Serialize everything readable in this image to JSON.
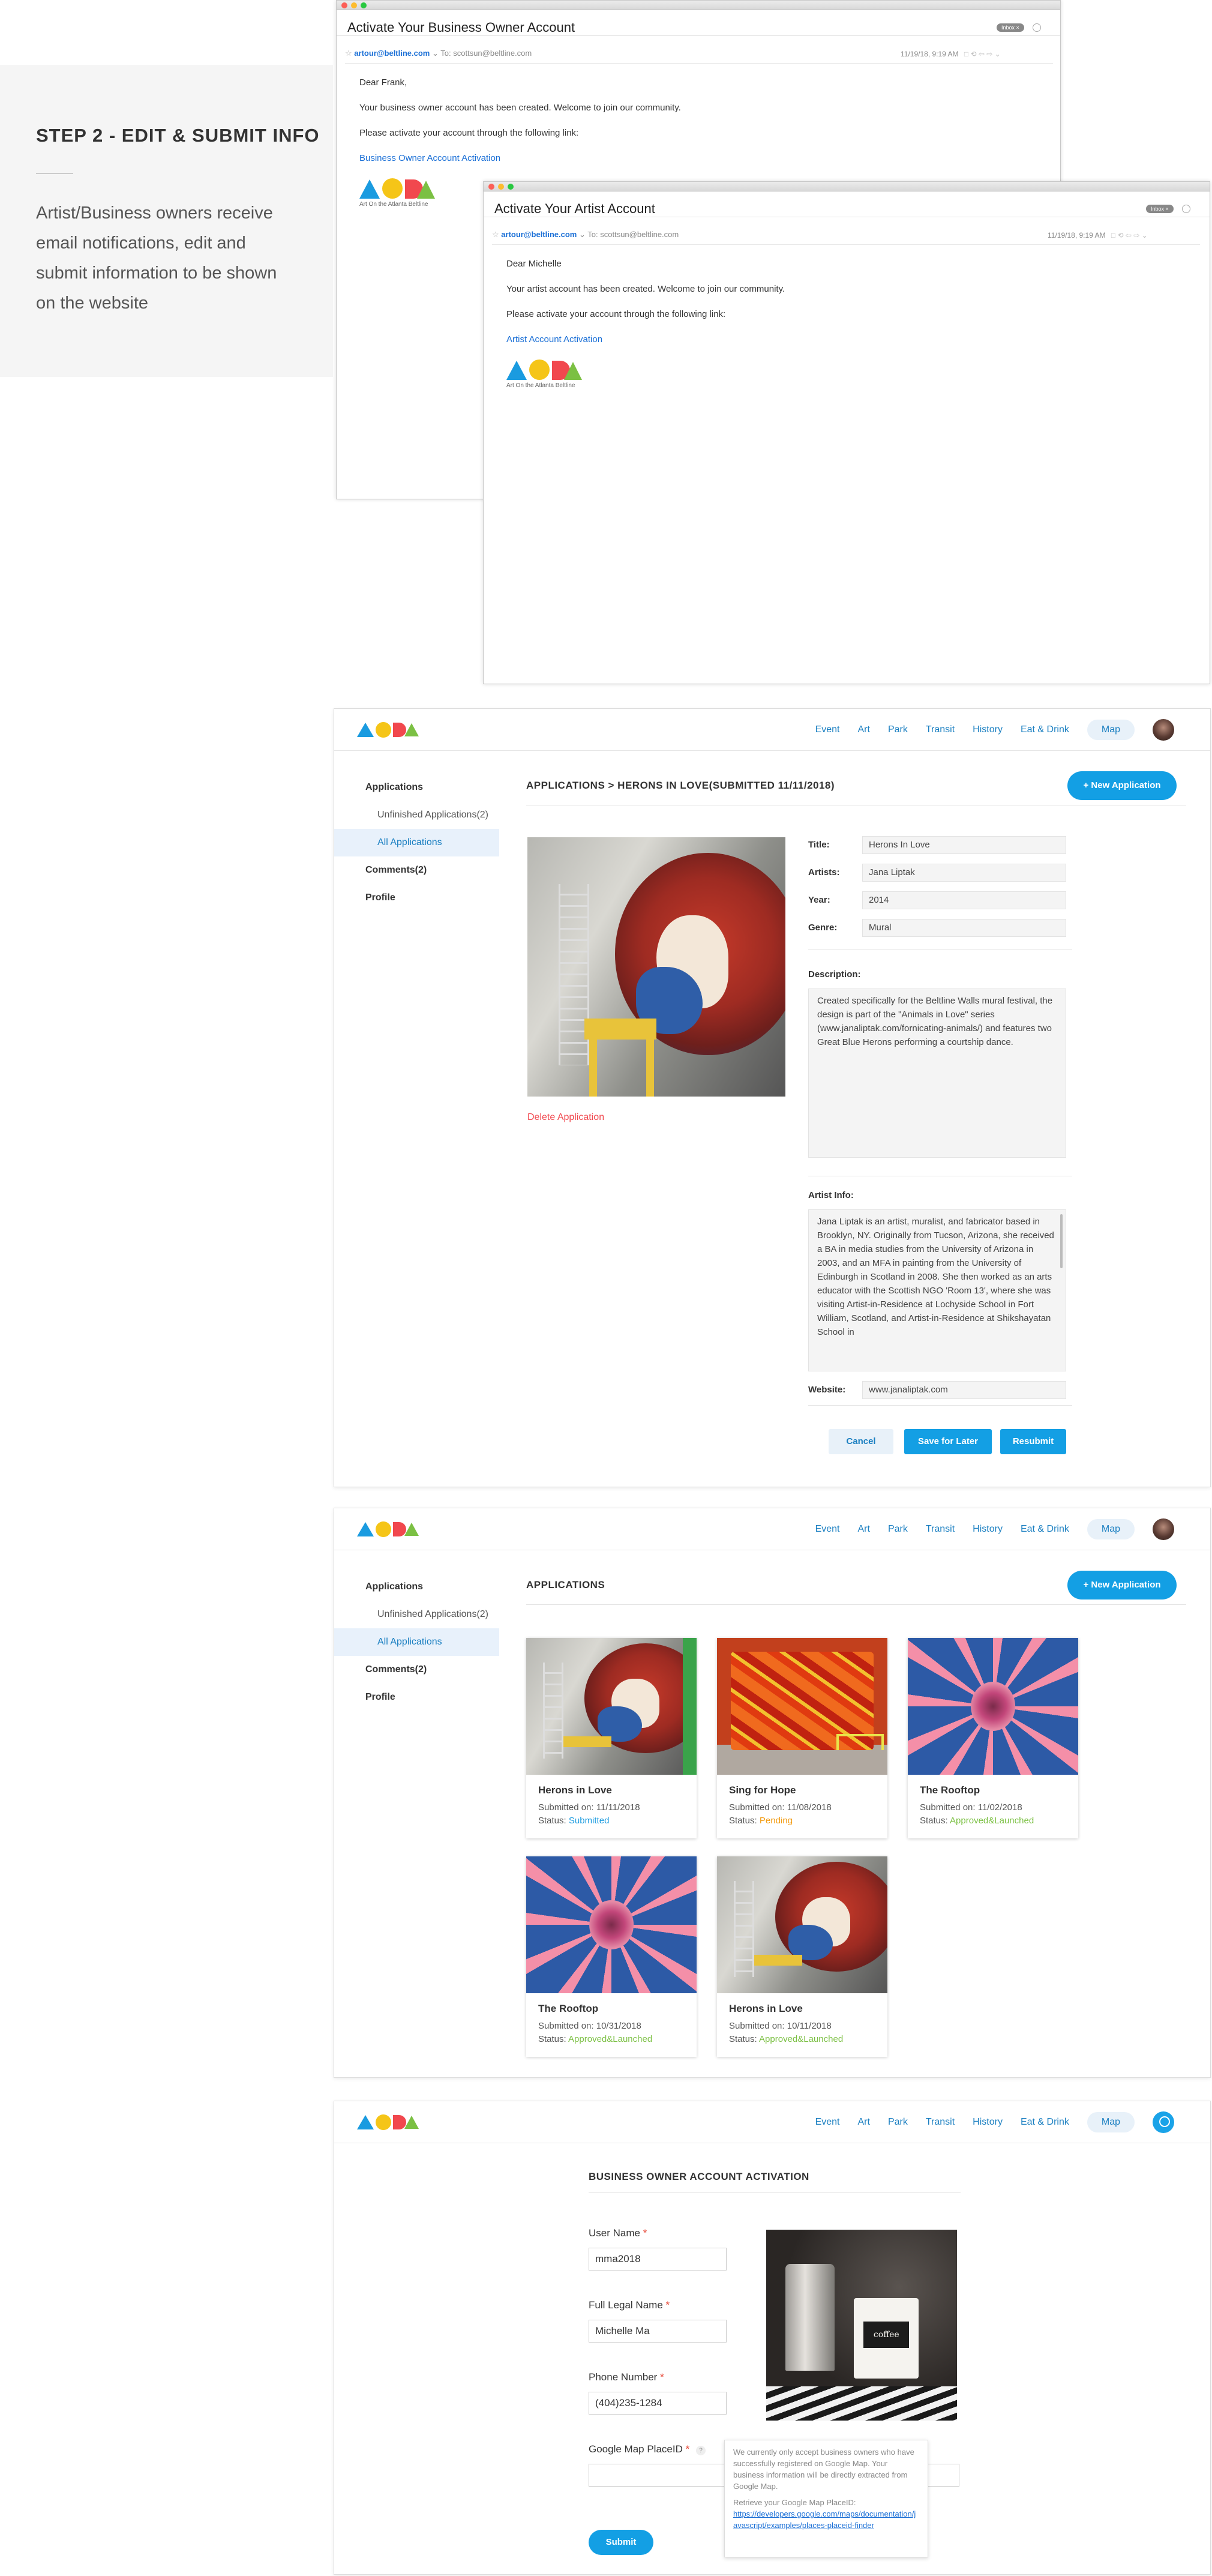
{
  "step": {
    "title": "STEP 2 - EDIT & SUBMIT INFO",
    "description": "Artist/Business owners receive email notifications, edit and submit information to be shown on the website"
  },
  "email_business": {
    "subject": "Activate Your Business Owner Account",
    "inbox_badge": "Inbox",
    "from": "artour@beltline.com",
    "to": "To: scottsun@beltline.com",
    "date": "11/19/18, 9:19 AM",
    "greeting": "Dear Frank,",
    "line1": "Your business owner account has been created. Welcome to join our community.",
    "line2": "Please activate your account through the following link:",
    "link": "Business Owner Account Activation",
    "logo_caption": "Art On the Atlanta Beltline"
  },
  "email_artist": {
    "subject": "Activate Your Artist Account",
    "inbox_badge": "Inbox",
    "from": "artour@beltline.com",
    "to": "To: scottsun@beltline.com",
    "date": "11/19/18, 9:19 AM",
    "greeting": "Dear Michelle",
    "line1": "Your artist account has been created. Welcome to join our community.",
    "line2": "Please activate your account through the following link:",
    "link": "Artist Account Activation",
    "logo_caption": "Art On the Atlanta Beltline"
  },
  "nav": {
    "items": [
      "Event",
      "Art",
      "Park",
      "Transit",
      "History",
      "Eat & Drink"
    ],
    "map": "Map"
  },
  "sidebar": {
    "applications": "Applications",
    "unfinished": "Unfinished Applications(2)",
    "all": "All Applications",
    "comments": "Comments(2)",
    "profile": "Profile"
  },
  "detail": {
    "breadcrumb": "APPLICATIONS  >  HERONS IN LOVE(SUBMITTED 11/11/2018)",
    "new_app": "+ New Application",
    "delete": "Delete Application",
    "title_label": "Title:",
    "title_value": "Herons In Love",
    "artists_label": "Artists:",
    "artists_value": "Jana Liptak",
    "year_label": "Year:",
    "year_value": "2014",
    "genre_label": "Genre:",
    "genre_value": "Mural",
    "description_label": "Description:",
    "description": "Created specifically for the Beltline Walls mural festival, the design is part of the \"Animals in Love\" series (www.janaliptak.com/fornicating-animals/) and features two Great Blue Herons performing a courtship dance.",
    "artist_info_label": "Artist Info:",
    "artist_info": "Jana Liptak is an artist, muralist, and fabricator based in Brooklyn, NY. Originally from Tucson, Arizona, she received a BA in media studies from the University of Arizona in 2003, and an MFA in painting from the University of Edinburgh in Scotland in 2008. She then worked as an arts educator with the Scottish NGO 'Room 13', where she was visiting Artist-in-Residence at Lochyside School in Fort William, Scotland, and Artist-in-Residence at Shikshayatan School in",
    "website_label": "Website:",
    "website_value": "www.janaliptak.com",
    "cancel": "Cancel",
    "save_later": "Save for Later",
    "resubmit": "Resubmit"
  },
  "list": {
    "title": "APPLICATIONS",
    "new_app": "+ New Application",
    "status_label": "Status:",
    "cards": [
      {
        "title": "Herons in Love",
        "submitted": "Submitted on: 11/11/2018",
        "status": "Submitted",
        "status_kind": "submitted"
      },
      {
        "title": "Sing for Hope",
        "submitted": "Submitted on: 11/08/2018",
        "status": "Pending",
        "status_kind": "pending"
      },
      {
        "title": "The Rooftop",
        "submitted": "Submitted on: 11/02/2018",
        "status": "Approved&Launched",
        "status_kind": "approved"
      },
      {
        "title": "The Rooftop",
        "submitted": "Submitted on: 10/31/2018",
        "status": "Approved&Launched",
        "status_kind": "approved"
      },
      {
        "title": "Herons in Love",
        "submitted": "Submitted on: 10/11/2018",
        "status": "Approved&Launched",
        "status_kind": "approved"
      }
    ]
  },
  "activation": {
    "title": "BUSINESS OWNER ACCOUNT ACTIVATION",
    "username_label": "User Name",
    "username_value": "mma2018",
    "legal_label": "Full Legal Name",
    "legal_value": "Michelle Ma",
    "phone_label": "Phone Number",
    "phone_value": "(404)235-1284",
    "placeid_label": "Google Map PlaceID",
    "required_mark": "*",
    "help_icon": "?",
    "mug_text": "coffee",
    "tooltip_text": "We currently only accept business owners who have successfully registered on Google Map. Your business information will be directly extracted from Google Map.",
    "tooltip_retrieve": "Retrieve your Google Map PlaceID:",
    "tooltip_link": "https://developers.google.com/maps/documentation/javascript/examples/places-placeid-finder",
    "submit": "Submit"
  },
  "colors": {
    "accent": "#139fe4",
    "submitted": "#1a9be0",
    "pending": "#f39c12",
    "approved": "#7bc043",
    "delete": "#f1484e"
  }
}
